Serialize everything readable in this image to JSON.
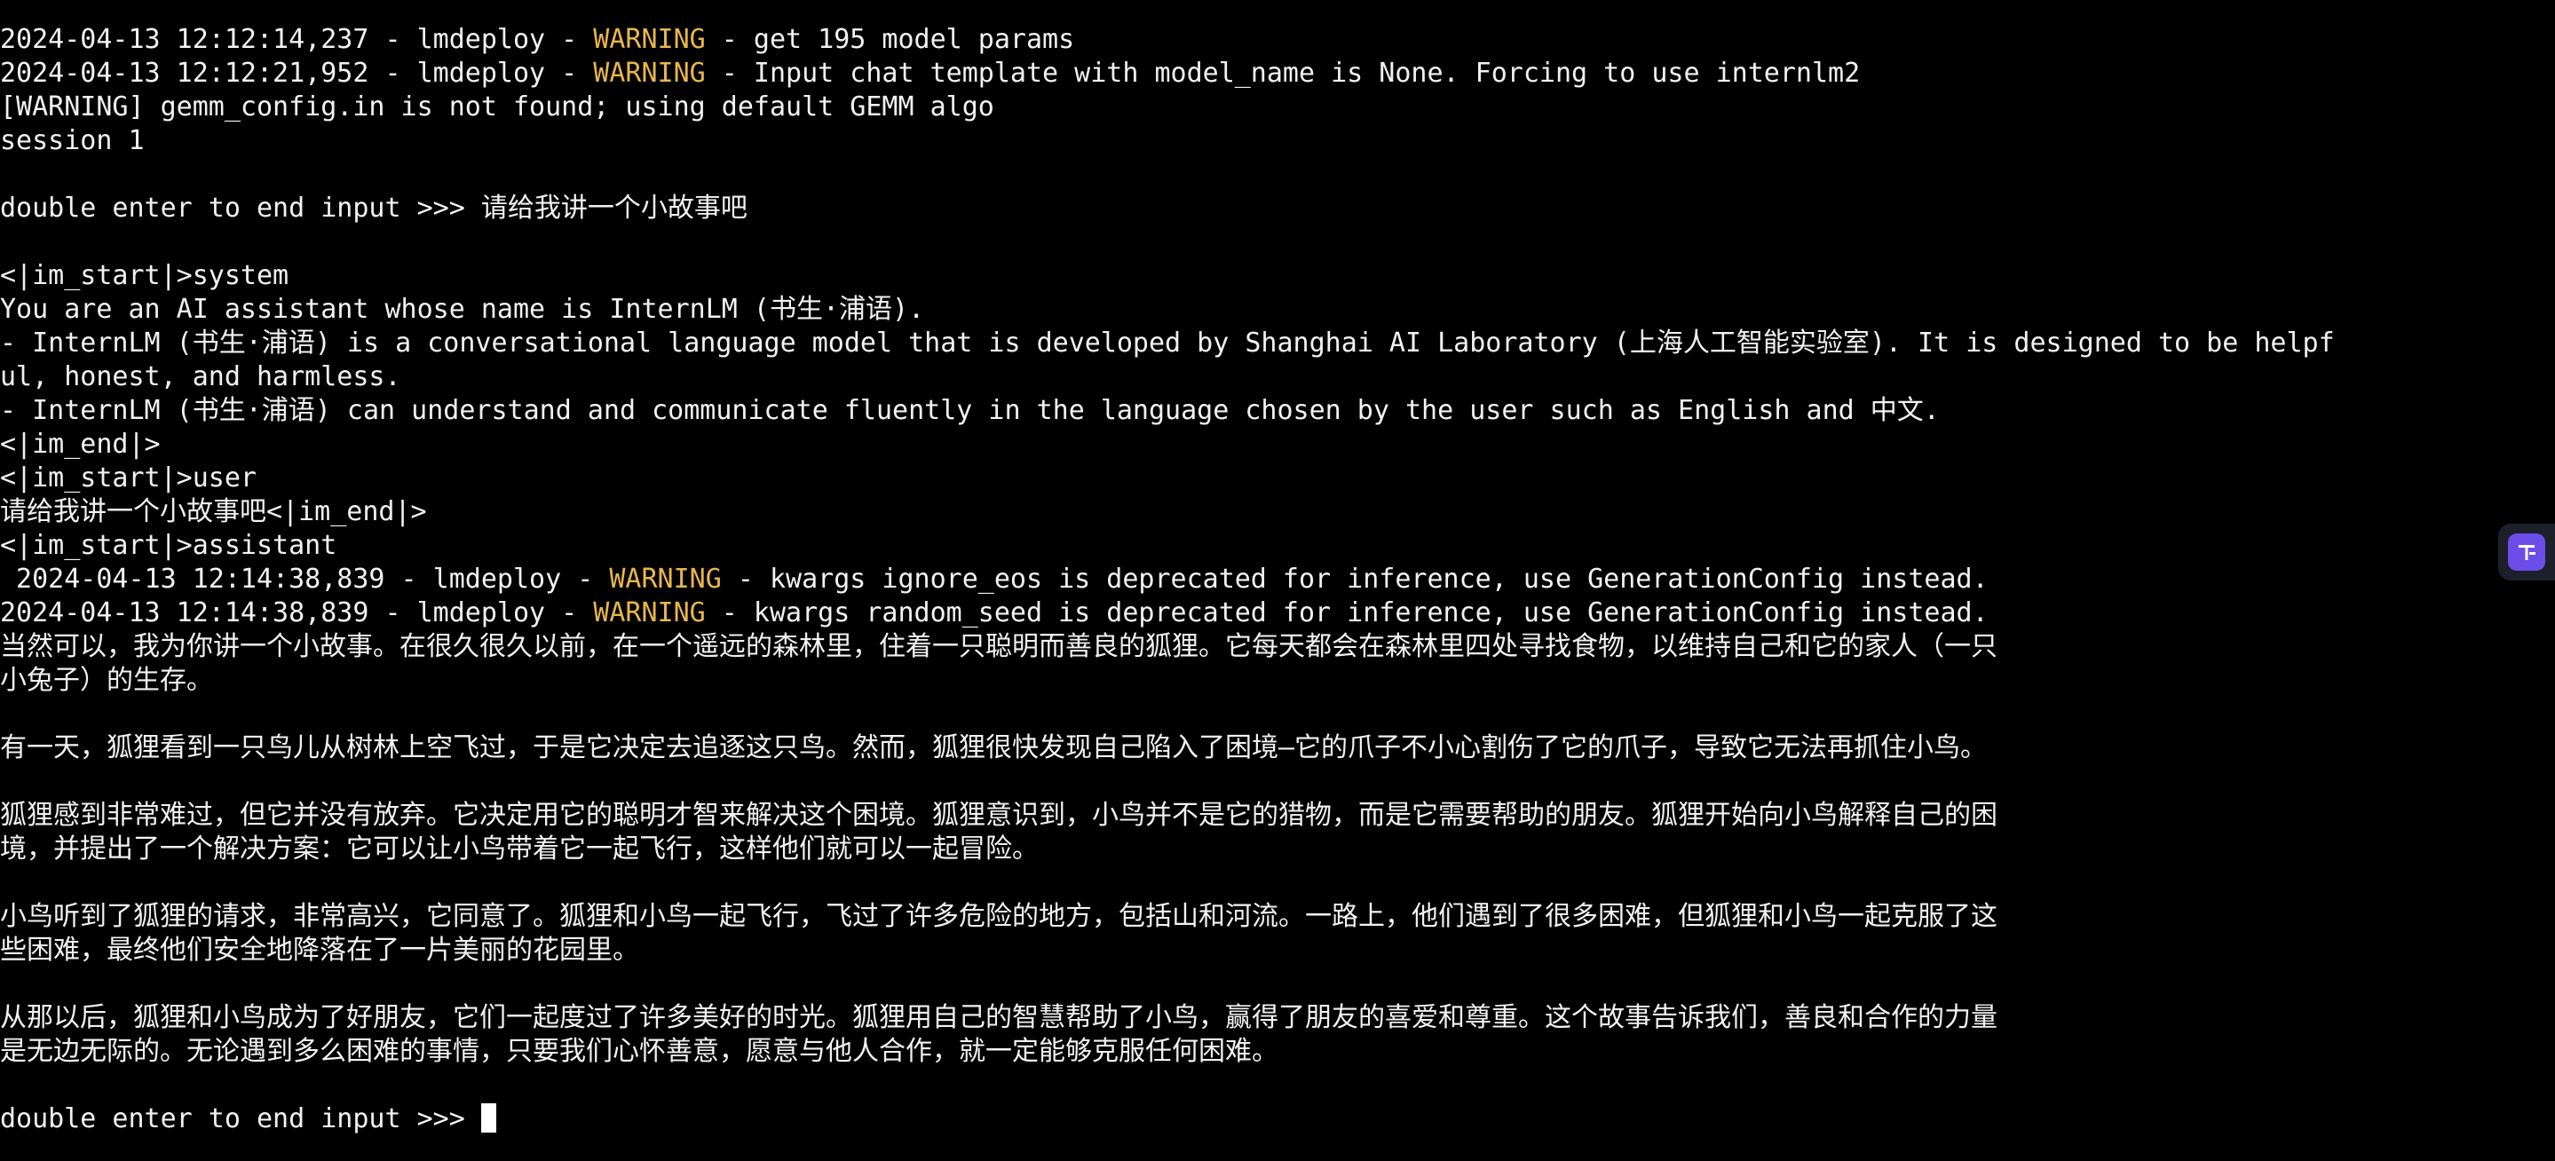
{
  "terminal": {
    "lines": [
      {
        "pre": "2024-04-13 12:12:14,237 - lmdeploy - ",
        "level": "WARNING",
        "post": " - get 195 model params"
      },
      {
        "pre": "2024-04-13 12:12:21,952 - lmdeploy - ",
        "level": "WARNING",
        "post": " - Input chat template with model_name is None. Forcing to use internlm2"
      },
      {
        "text": "[WARNING] gemm_config.in is not found; using default GEMM algo"
      },
      {
        "text": "session 1"
      },
      {
        "text": ""
      },
      {
        "text": "double enter to end input >>> 请给我讲一个小故事吧"
      },
      {
        "text": ""
      },
      {
        "text": "<|im_start|>system"
      },
      {
        "text": "You are an AI assistant whose name is InternLM (书生·浦语)."
      },
      {
        "text": "- InternLM (书生·浦语) is a conversational language model that is developed by Shanghai AI Laboratory (上海人工智能实验室). It is designed to be helpf"
      },
      {
        "text": "ul, honest, and harmless."
      },
      {
        "text": "- InternLM (书生·浦语) can understand and communicate fluently in the language chosen by the user such as English and 中文."
      },
      {
        "text": "<|im_end|>"
      },
      {
        "text": "<|im_start|>user"
      },
      {
        "text": "请给我讲一个小故事吧<|im_end|>"
      },
      {
        "text": "<|im_start|>assistant"
      },
      {
        "pre": " 2024-04-13 12:14:38,839 - lmdeploy - ",
        "level": "WARNING",
        "post": " - kwargs ignore_eos is deprecated for inference, use GenerationConfig instead."
      },
      {
        "pre": "2024-04-13 12:14:38,839 - lmdeploy - ",
        "level": "WARNING",
        "post": " - kwargs random_seed is deprecated for inference, use GenerationConfig instead."
      },
      {
        "text": "当然可以，我为你讲一个小故事。在很久很久以前，在一个遥远的森林里，住着一只聪明而善良的狐狸。它每天都会在森林里四处寻找食物，以维持自己和它的家人（一只"
      },
      {
        "text": "小兔子）的生存。"
      },
      {
        "text": ""
      },
      {
        "text": "有一天，狐狸看到一只鸟儿从树林上空飞过，于是它决定去追逐这只鸟。然而，狐狸很快发现自己陷入了困境—它的爪子不小心割伤了它的爪子，导致它无法再抓住小鸟。"
      },
      {
        "text": ""
      },
      {
        "text": "狐狸感到非常难过，但它并没有放弃。它决定用它的聪明才智来解决这个困境。狐狸意识到，小鸟并不是它的猎物，而是它需要帮助的朋友。狐狸开始向小鸟解释自己的困"
      },
      {
        "text": "境，并提出了一个解决方案：它可以让小鸟带着它一起飞行，这样他们就可以一起冒险。"
      },
      {
        "text": ""
      },
      {
        "text": "小鸟听到了狐狸的请求，非常高兴，它同意了。狐狸和小鸟一起飞行，飞过了许多危险的地方，包括山和河流。一路上，他们遇到了很多困难，但狐狸和小鸟一起克服了这"
      },
      {
        "text": "些困难，最终他们安全地降落在了一片美丽的花园里。"
      },
      {
        "text": ""
      },
      {
        "text": "从那以后，狐狸和小鸟成为了好朋友，它们一起度过了许多美好的时光。狐狸用自己的智慧帮助了小鸟，赢得了朋友的喜爱和尊重。这个故事告诉我们，善良和合作的力量"
      },
      {
        "text": "是无边无际的。无论遇到多么困难的事情，只要我们心怀善意，愿意与他人合作，就一定能够克服任何困难。"
      },
      {
        "text": ""
      }
    ],
    "prompt": "double enter to end input >>> "
  },
  "colors": {
    "background": "#000000",
    "foreground": "#f2f2f2",
    "warning": "#e8b64b",
    "widget_accent": "#6b4ee8"
  },
  "floating_widget": {
    "icon": "translate-assistant-icon"
  }
}
